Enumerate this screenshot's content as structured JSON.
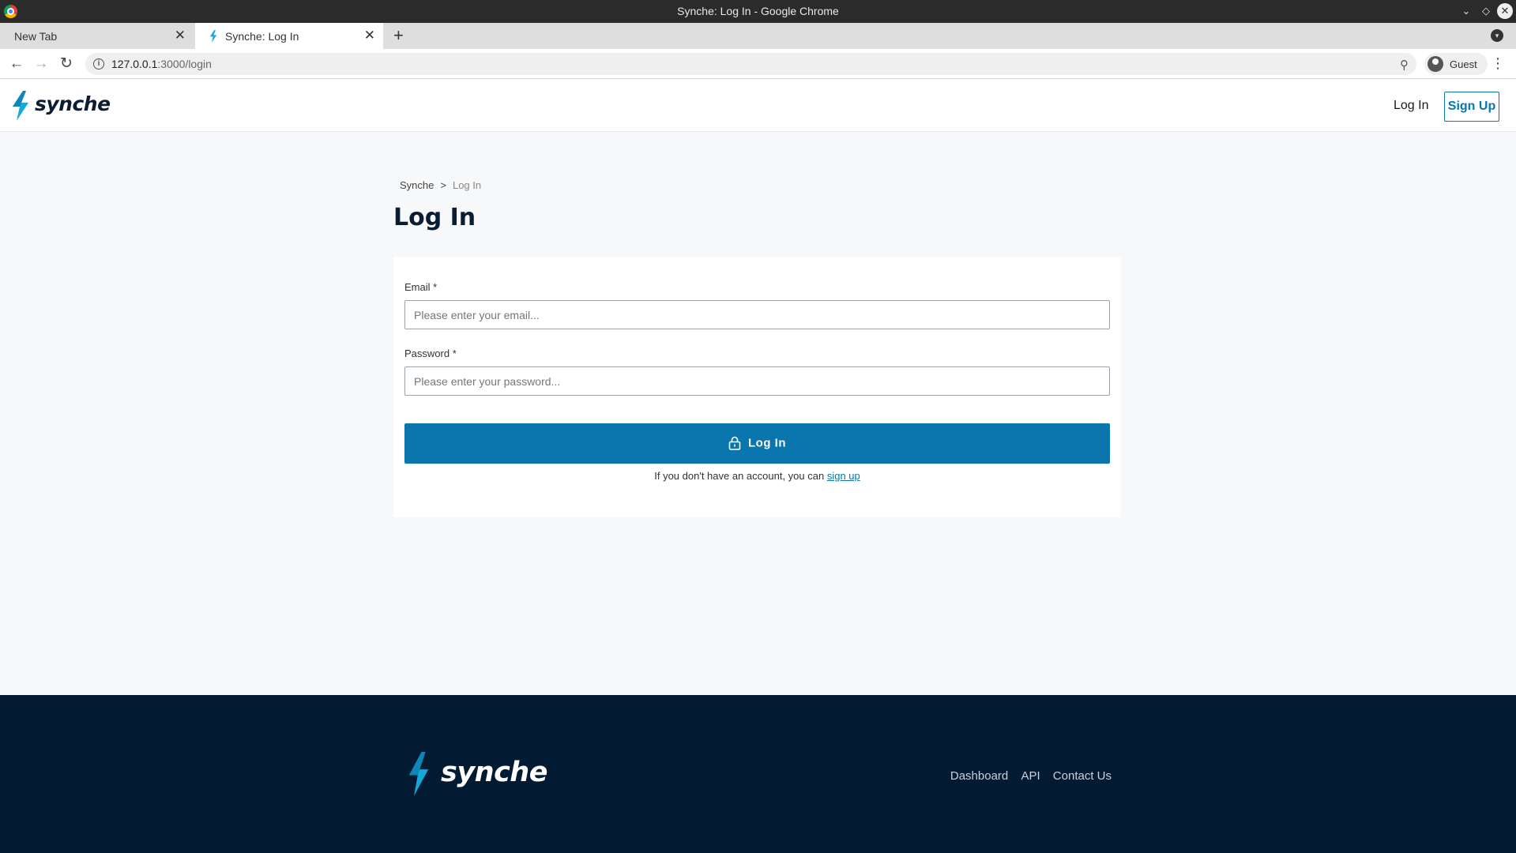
{
  "window": {
    "title": "Synche: Log In - Google Chrome",
    "controls": {
      "minimize": "⌄",
      "maximize": "◇",
      "close": "✕"
    }
  },
  "tabs": [
    {
      "label": "New Tab",
      "active": false
    },
    {
      "label": "Synche: Log In",
      "active": true
    }
  ],
  "browser": {
    "url_host": "127.0.0.1",
    "url_path": ":3000/login",
    "profile_label": "Guest",
    "new_tab_label": "+",
    "tab_close": "✕"
  },
  "site": {
    "brand_name": "synche",
    "brand_color": "#14a9d6",
    "header": {
      "login_label": "Log In",
      "signup_label": "Sign Up"
    },
    "breadcrumb": {
      "root": "Synche",
      "separator": ">",
      "current": "Log In"
    },
    "page_title": "Log In",
    "form": {
      "email_label": "Email",
      "email_placeholder": "Please enter your email...",
      "email_value": "",
      "password_label": "Password",
      "password_placeholder": "Please enter your password...",
      "password_value": "",
      "required_mark": "*",
      "submit_label": "Log In",
      "submit_icon": "lock-icon",
      "signup_text": "If you don't have an account, you can",
      "signup_link": "sign up"
    },
    "footer": {
      "brand_name": "synche",
      "links": [
        "Dashboard",
        "API",
        "Contact Us"
      ]
    },
    "colors": {
      "primary": "#0a76ad",
      "navy": "#021b33",
      "page_bg": "#f7f8fa"
    }
  }
}
